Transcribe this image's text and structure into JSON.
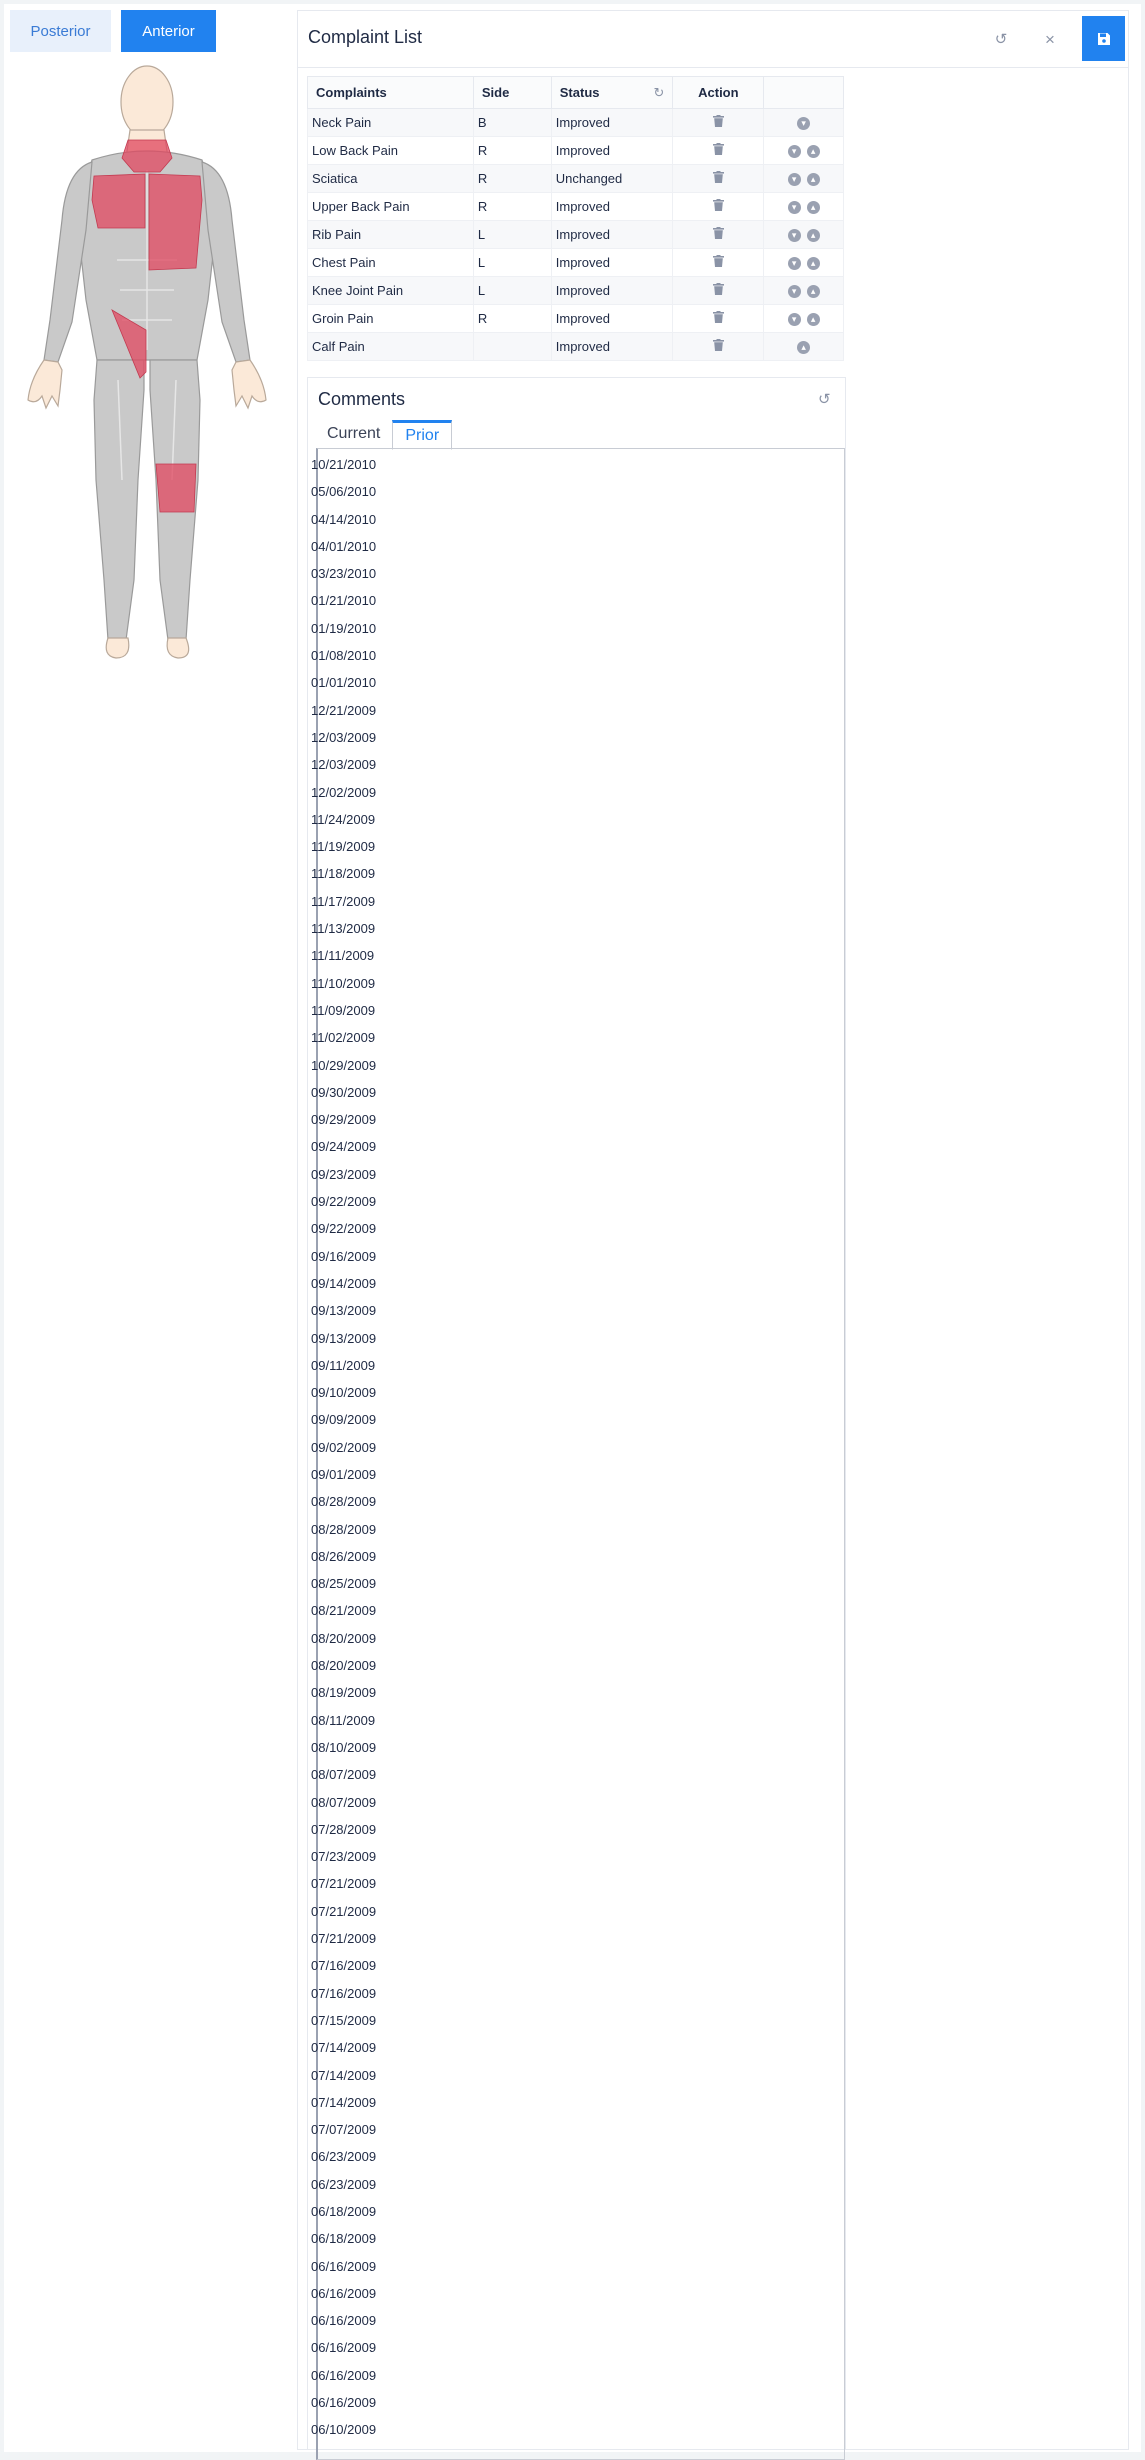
{
  "view_toggle": {
    "posterior": "Posterior",
    "anterior": "Anterior"
  },
  "panel": {
    "title": "Complaint List"
  },
  "table": {
    "headers": {
      "complaints": "Complaints",
      "side": "Side",
      "status": "Status",
      "action": "Action"
    },
    "rows": [
      {
        "complaint": "Neck Pain",
        "side": "B",
        "status": "Improved"
      },
      {
        "complaint": "Low Back Pain",
        "side": "R",
        "status": "Improved"
      },
      {
        "complaint": "Sciatica",
        "side": "R",
        "status": "Unchanged"
      },
      {
        "complaint": "Upper Back Pain",
        "side": "R",
        "status": "Improved"
      },
      {
        "complaint": "Rib Pain",
        "side": "L",
        "status": "Improved"
      },
      {
        "complaint": "Chest Pain",
        "side": "L",
        "status": "Improved"
      },
      {
        "complaint": "Knee Joint Pain",
        "side": "L",
        "status": "Improved"
      },
      {
        "complaint": "Groin Pain",
        "side": "R",
        "status": "Improved"
      },
      {
        "complaint": "Calf Pain",
        "side": "",
        "status": "Improved"
      }
    ]
  },
  "comments": {
    "title": "Comments",
    "tabs": {
      "current": "Current",
      "prior": "Prior"
    },
    "dates": [
      "10/21/2010",
      "05/06/2010",
      "04/14/2010",
      "04/01/2010",
      "03/23/2010",
      "01/21/2010",
      "01/19/2010",
      "01/08/2010",
      "01/01/2010",
      "12/21/2009",
      "12/03/2009",
      "12/03/2009",
      "12/02/2009",
      "11/24/2009",
      "11/19/2009",
      "11/18/2009",
      "11/17/2009",
      "11/13/2009",
      "11/11/2009",
      "11/10/2009",
      "11/09/2009",
      "11/02/2009",
      "10/29/2009",
      "09/30/2009",
      "09/29/2009",
      "09/24/2009",
      "09/23/2009",
      "09/22/2009",
      "09/22/2009",
      "09/16/2009",
      "09/14/2009",
      "09/13/2009",
      "09/13/2009",
      "09/11/2009",
      "09/10/2009",
      "09/09/2009",
      "09/02/2009",
      "09/01/2009",
      "08/28/2009",
      "08/28/2009",
      "08/26/2009",
      "08/25/2009",
      "08/21/2009",
      "08/20/2009",
      "08/20/2009",
      "08/19/2009",
      "08/11/2009",
      "08/10/2009",
      "08/07/2009",
      "08/07/2009",
      "07/28/2009",
      "07/23/2009",
      "07/21/2009",
      "07/21/2009",
      "07/21/2009",
      "07/16/2009",
      "07/16/2009",
      "07/15/2009",
      "07/14/2009",
      "07/14/2009",
      "07/14/2009",
      "07/07/2009",
      "06/23/2009",
      "06/23/2009",
      "06/18/2009",
      "06/18/2009",
      "06/16/2009",
      "06/16/2009",
      "06/16/2009",
      "06/16/2009",
      "06/16/2009",
      "06/16/2009",
      "06/10/2009"
    ]
  },
  "colors": {
    "accent": "#2182ef",
    "highlight": "#e0475f"
  }
}
